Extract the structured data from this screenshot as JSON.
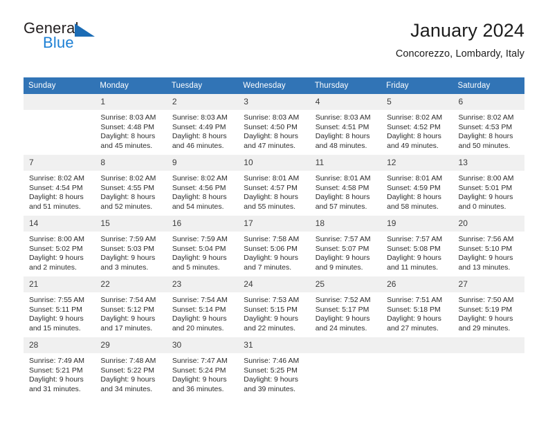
{
  "brand": {
    "name_part1": "General",
    "name_part2": "Blue",
    "accent_color": "#1b6cb5"
  },
  "header": {
    "title": "January 2024",
    "subtitle": "Concorezzo, Lombardy, Italy"
  },
  "calendar": {
    "header_color": "#3174b6",
    "weekday_headers": [
      "Sunday",
      "Monday",
      "Tuesday",
      "Wednesday",
      "Thursday",
      "Friday",
      "Saturday"
    ],
    "labels": {
      "sunrise": "Sunrise:",
      "sunset": "Sunset:",
      "daylight": "Daylight:"
    },
    "weeks": [
      [
        {
          "day": "",
          "sunrise": "",
          "sunset": "",
          "daylight": ""
        },
        {
          "day": "1",
          "sunrise": "Sunrise: 8:03 AM",
          "sunset": "Sunset: 4:48 PM",
          "daylight": "Daylight: 8 hours and 45 minutes."
        },
        {
          "day": "2",
          "sunrise": "Sunrise: 8:03 AM",
          "sunset": "Sunset: 4:49 PM",
          "daylight": "Daylight: 8 hours and 46 minutes."
        },
        {
          "day": "3",
          "sunrise": "Sunrise: 8:03 AM",
          "sunset": "Sunset: 4:50 PM",
          "daylight": "Daylight: 8 hours and 47 minutes."
        },
        {
          "day": "4",
          "sunrise": "Sunrise: 8:03 AM",
          "sunset": "Sunset: 4:51 PM",
          "daylight": "Daylight: 8 hours and 48 minutes."
        },
        {
          "day": "5",
          "sunrise": "Sunrise: 8:02 AM",
          "sunset": "Sunset: 4:52 PM",
          "daylight": "Daylight: 8 hours and 49 minutes."
        },
        {
          "day": "6",
          "sunrise": "Sunrise: 8:02 AM",
          "sunset": "Sunset: 4:53 PM",
          "daylight": "Daylight: 8 hours and 50 minutes."
        }
      ],
      [
        {
          "day": "7",
          "sunrise": "Sunrise: 8:02 AM",
          "sunset": "Sunset: 4:54 PM",
          "daylight": "Daylight: 8 hours and 51 minutes."
        },
        {
          "day": "8",
          "sunrise": "Sunrise: 8:02 AM",
          "sunset": "Sunset: 4:55 PM",
          "daylight": "Daylight: 8 hours and 52 minutes."
        },
        {
          "day": "9",
          "sunrise": "Sunrise: 8:02 AM",
          "sunset": "Sunset: 4:56 PM",
          "daylight": "Daylight: 8 hours and 54 minutes."
        },
        {
          "day": "10",
          "sunrise": "Sunrise: 8:01 AM",
          "sunset": "Sunset: 4:57 PM",
          "daylight": "Daylight: 8 hours and 55 minutes."
        },
        {
          "day": "11",
          "sunrise": "Sunrise: 8:01 AM",
          "sunset": "Sunset: 4:58 PM",
          "daylight": "Daylight: 8 hours and 57 minutes."
        },
        {
          "day": "12",
          "sunrise": "Sunrise: 8:01 AM",
          "sunset": "Sunset: 4:59 PM",
          "daylight": "Daylight: 8 hours and 58 minutes."
        },
        {
          "day": "13",
          "sunrise": "Sunrise: 8:00 AM",
          "sunset": "Sunset: 5:01 PM",
          "daylight": "Daylight: 9 hours and 0 minutes."
        }
      ],
      [
        {
          "day": "14",
          "sunrise": "Sunrise: 8:00 AM",
          "sunset": "Sunset: 5:02 PM",
          "daylight": "Daylight: 9 hours and 2 minutes."
        },
        {
          "day": "15",
          "sunrise": "Sunrise: 7:59 AM",
          "sunset": "Sunset: 5:03 PM",
          "daylight": "Daylight: 9 hours and 3 minutes."
        },
        {
          "day": "16",
          "sunrise": "Sunrise: 7:59 AM",
          "sunset": "Sunset: 5:04 PM",
          "daylight": "Daylight: 9 hours and 5 minutes."
        },
        {
          "day": "17",
          "sunrise": "Sunrise: 7:58 AM",
          "sunset": "Sunset: 5:06 PM",
          "daylight": "Daylight: 9 hours and 7 minutes."
        },
        {
          "day": "18",
          "sunrise": "Sunrise: 7:57 AM",
          "sunset": "Sunset: 5:07 PM",
          "daylight": "Daylight: 9 hours and 9 minutes."
        },
        {
          "day": "19",
          "sunrise": "Sunrise: 7:57 AM",
          "sunset": "Sunset: 5:08 PM",
          "daylight": "Daylight: 9 hours and 11 minutes."
        },
        {
          "day": "20",
          "sunrise": "Sunrise: 7:56 AM",
          "sunset": "Sunset: 5:10 PM",
          "daylight": "Daylight: 9 hours and 13 minutes."
        }
      ],
      [
        {
          "day": "21",
          "sunrise": "Sunrise: 7:55 AM",
          "sunset": "Sunset: 5:11 PM",
          "daylight": "Daylight: 9 hours and 15 minutes."
        },
        {
          "day": "22",
          "sunrise": "Sunrise: 7:54 AM",
          "sunset": "Sunset: 5:12 PM",
          "daylight": "Daylight: 9 hours and 17 minutes."
        },
        {
          "day": "23",
          "sunrise": "Sunrise: 7:54 AM",
          "sunset": "Sunset: 5:14 PM",
          "daylight": "Daylight: 9 hours and 20 minutes."
        },
        {
          "day": "24",
          "sunrise": "Sunrise: 7:53 AM",
          "sunset": "Sunset: 5:15 PM",
          "daylight": "Daylight: 9 hours and 22 minutes."
        },
        {
          "day": "25",
          "sunrise": "Sunrise: 7:52 AM",
          "sunset": "Sunset: 5:17 PM",
          "daylight": "Daylight: 9 hours and 24 minutes."
        },
        {
          "day": "26",
          "sunrise": "Sunrise: 7:51 AM",
          "sunset": "Sunset: 5:18 PM",
          "daylight": "Daylight: 9 hours and 27 minutes."
        },
        {
          "day": "27",
          "sunrise": "Sunrise: 7:50 AM",
          "sunset": "Sunset: 5:19 PM",
          "daylight": "Daylight: 9 hours and 29 minutes."
        }
      ],
      [
        {
          "day": "28",
          "sunrise": "Sunrise: 7:49 AM",
          "sunset": "Sunset: 5:21 PM",
          "daylight": "Daylight: 9 hours and 31 minutes."
        },
        {
          "day": "29",
          "sunrise": "Sunrise: 7:48 AM",
          "sunset": "Sunset: 5:22 PM",
          "daylight": "Daylight: 9 hours and 34 minutes."
        },
        {
          "day": "30",
          "sunrise": "Sunrise: 7:47 AM",
          "sunset": "Sunset: 5:24 PM",
          "daylight": "Daylight: 9 hours and 36 minutes."
        },
        {
          "day": "31",
          "sunrise": "Sunrise: 7:46 AM",
          "sunset": "Sunset: 5:25 PM",
          "daylight": "Daylight: 9 hours and 39 minutes."
        },
        {
          "day": "",
          "sunrise": "",
          "sunset": "",
          "daylight": ""
        },
        {
          "day": "",
          "sunrise": "",
          "sunset": "",
          "daylight": ""
        },
        {
          "day": "",
          "sunrise": "",
          "sunset": "",
          "daylight": ""
        }
      ]
    ]
  }
}
